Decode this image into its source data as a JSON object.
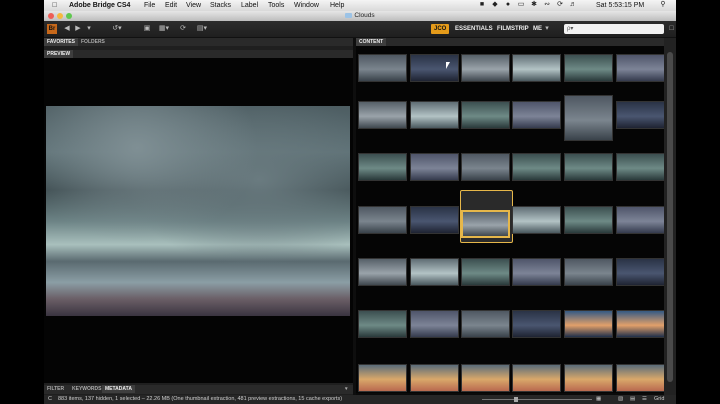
{
  "menubar": {
    "app_name": "Adobe Bridge CS4",
    "items": [
      "File",
      "Edit",
      "View",
      "Stacks",
      "Label",
      "Tools",
      "Window",
      "Help"
    ],
    "clock": "Sat 5:53:15 PM"
  },
  "window": {
    "title": "Clouds"
  },
  "toolbar": {
    "workspaces": [
      "JCO",
      "ESSENTIALS",
      "FILMSTRIP",
      "ME"
    ],
    "active_workspace": "JCO",
    "search_placeholder": "ρ▾"
  },
  "left_panel": {
    "top_tabs": [
      "FAVORITES",
      "FOLDERS"
    ],
    "preview_tab": "PREVIEW",
    "bottom_tabs": [
      "FILTER",
      "KEYWORDS",
      "METADATA"
    ]
  },
  "right_panel": {
    "tab": "CONTENT"
  },
  "status": {
    "text": "883 items, 137 hidden, 1 selected – 22.26 MB (One thumbnail extraction, 481 preview extractions, 15 cache exports)",
    "right_label": "Grid"
  },
  "colors": {
    "accent": "#e59b1a",
    "selection": "#e6b74a"
  }
}
